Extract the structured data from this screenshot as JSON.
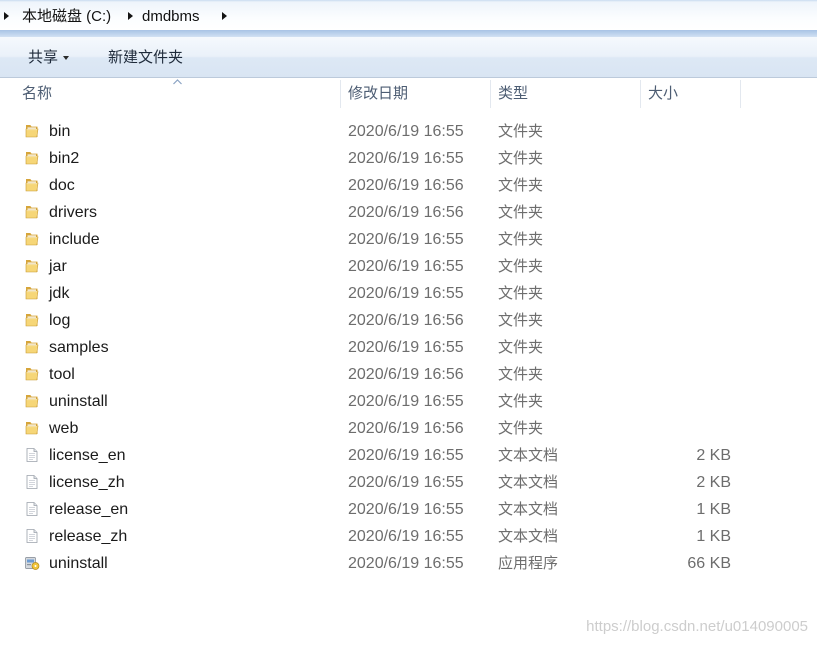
{
  "address_bar": {
    "segments": [
      "本地磁盘 (C:)",
      "dmdbms"
    ]
  },
  "toolbar": {
    "share_label": "共享",
    "new_folder_label": "新建文件夹"
  },
  "columns": {
    "name": "名称",
    "modified": "修改日期",
    "type": "类型",
    "size": "大小"
  },
  "icons": {
    "breadcrumb_separator": "chevron-right-icon",
    "share_dropdown": "caret-down-icon",
    "sort_indicator": "sort-up-icon"
  },
  "files": [
    {
      "icon": "folder-icon",
      "name": "bin",
      "modified": "2020/6/19 16:55",
      "type": "文件夹"
    },
    {
      "icon": "folder-icon",
      "name": "bin2",
      "modified": "2020/6/19 16:55",
      "type": "文件夹"
    },
    {
      "icon": "folder-icon",
      "name": "doc",
      "modified": "2020/6/19 16:56",
      "type": "文件夹"
    },
    {
      "icon": "folder-icon",
      "name": "drivers",
      "modified": "2020/6/19 16:56",
      "type": "文件夹"
    },
    {
      "icon": "folder-icon",
      "name": "include",
      "modified": "2020/6/19 16:55",
      "type": "文件夹"
    },
    {
      "icon": "folder-icon",
      "name": "jar",
      "modified": "2020/6/19 16:55",
      "type": "文件夹"
    },
    {
      "icon": "folder-icon",
      "name": "jdk",
      "modified": "2020/6/19 16:55",
      "type": "文件夹"
    },
    {
      "icon": "folder-icon",
      "name": "log",
      "modified": "2020/6/19 16:56",
      "type": "文件夹"
    },
    {
      "icon": "folder-icon",
      "name": "samples",
      "modified": "2020/6/19 16:55",
      "type": "文件夹"
    },
    {
      "icon": "folder-icon",
      "name": "tool",
      "modified": "2020/6/19 16:56",
      "type": "文件夹"
    },
    {
      "icon": "folder-icon",
      "name": "uninstall",
      "modified": "2020/6/19 16:55",
      "type": "文件夹"
    },
    {
      "icon": "folder-icon",
      "name": "web",
      "modified": "2020/6/19 16:56",
      "type": "文件夹"
    },
    {
      "icon": "text-document-icon",
      "name": "license_en",
      "modified": "2020/6/19 16:55",
      "type": "文本文档",
      "size": "2 KB"
    },
    {
      "icon": "text-document-icon",
      "name": "license_zh",
      "modified": "2020/6/19 16:55",
      "type": "文本文档",
      "size": "2 KB"
    },
    {
      "icon": "text-document-icon",
      "name": "release_en",
      "modified": "2020/6/19 16:55",
      "type": "文本文档",
      "size": "1 KB"
    },
    {
      "icon": "text-document-icon",
      "name": "release_zh",
      "modified": "2020/6/19 16:55",
      "type": "文本文档",
      "size": "1 KB"
    },
    {
      "icon": "application-icon",
      "name": "uninstall",
      "modified": "2020/6/19 16:55",
      "type": "应用程序",
      "size": "66 KB"
    }
  ],
  "watermark": "https://blog.csdn.net/u014090005",
  "colors": {
    "toolbar_gradient_top": "#f5f9fd",
    "toolbar_gradient_bottom": "#d9e5f3",
    "header_text": "#4d5d73",
    "detail_text": "#6d6d6d",
    "folder_yellow": "#f6d677",
    "watermark_text": "#cdcdcd"
  }
}
